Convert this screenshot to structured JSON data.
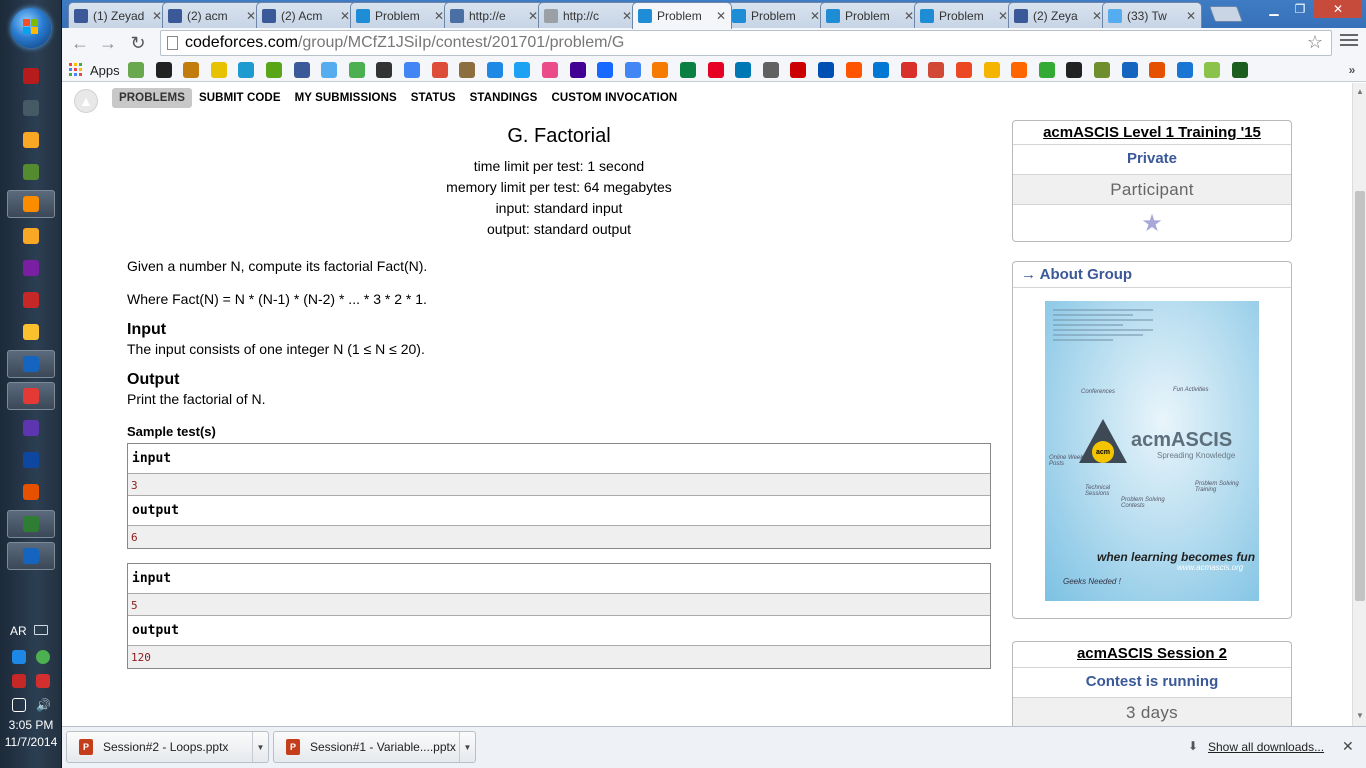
{
  "taskbar": {
    "icons": [
      "ar-app",
      "monitor",
      "media",
      "notes",
      "player",
      "explorer",
      "vs",
      "pdf",
      "messenger",
      "paint",
      "chrome",
      "vs-blend",
      "photoshop",
      "illustrator",
      "utorrent",
      "word"
    ],
    "lang": "AR",
    "time": "3:05 PM",
    "date": "11/7/2014"
  },
  "tabs": [
    {
      "title": "(1) Zeyad",
      "fav": "f",
      "color": "#3b5998"
    },
    {
      "title": "(2) acm",
      "fav": "f",
      "color": "#3b5998"
    },
    {
      "title": "(2) Acm",
      "fav": "f",
      "color": "#3b5998"
    },
    {
      "title": "Problem",
      "fav": "cf",
      "color": "#1f8dd6"
    },
    {
      "title": "http://e",
      "fav": "(",
      "color": "#4a6fa5"
    },
    {
      "title": "http://c",
      "fav": "doc",
      "color": "#9aa0a6"
    },
    {
      "title": "Problem",
      "fav": "cf",
      "color": "#1f8dd6"
    },
    {
      "title": "Problem",
      "fav": "cf",
      "color": "#1f8dd6"
    },
    {
      "title": "Problem",
      "fav": "cf",
      "color": "#1f8dd6"
    },
    {
      "title": "Problem",
      "fav": "cf",
      "color": "#1f8dd6"
    },
    {
      "title": "(2) Zeya",
      "fav": "f",
      "color": "#3b5998"
    },
    {
      "title": "(33) Tw",
      "fav": "t",
      "color": "#55acee"
    }
  ],
  "active_tab_index": 6,
  "address": {
    "host": "codeforces.com",
    "path": "/group/MCfZ1JSiIp/contest/201701/problem/G"
  },
  "bookmarks": {
    "apps_label": "Apps",
    "colors": [
      "#6aa84f",
      "#222",
      "#c27c0e",
      "#e6c200",
      "#1d9bd1",
      "#58a618",
      "#3b5998",
      "#55acee",
      "#4caf50",
      "#333",
      "#4285f4",
      "#dd4b39",
      "#8d6e3f",
      "#1e88e5",
      "#1da1f2",
      "#ea4c89",
      "#410093",
      "#1769ff",
      "#4285f4",
      "#f57c00",
      "#0b8043",
      "#e60023",
      "#0077b5",
      "#616161",
      "#cc0000",
      "#0050b3",
      "#ff5500",
      "#0078d4",
      "#d9302c",
      "#d14836",
      "#eb4924",
      "#f4b400",
      "#ff6600",
      "#33aa33",
      "#222",
      "#6f8f2f",
      "#1565c0",
      "#e65100",
      "#1976d2",
      "#8bc34a",
      "#1b5e20"
    ]
  },
  "menu": {
    "items": [
      "PROBLEMS",
      "SUBMIT CODE",
      "MY SUBMISSIONS",
      "STATUS",
      "STANDINGS",
      "CUSTOM INVOCATION"
    ],
    "current": 0
  },
  "problem": {
    "title": "G. Factorial",
    "time_limit": "time limit per test: 1 second",
    "memory_limit": "memory limit per test: 64 megabytes",
    "input": "input: standard input",
    "output": "output: standard output",
    "statement_1": "Given a number N, compute its factorial Fact(N).",
    "statement_2": "Where Fact(N) = N * (N-1) * (N-2) * ... * 3 * 2 * 1.",
    "input_title": "Input",
    "input_text": "The input consists of one integer N (1  ≤  N  ≤  20).",
    "output_title": "Output",
    "output_text": "Print the factorial of N.",
    "samples_title": "Sample test(s)",
    "samples": [
      {
        "input_label": "input",
        "input": "3",
        "output_label": "output",
        "output": "6"
      },
      {
        "input_label": "input",
        "input": "5",
        "output_label": "output",
        "output": "120"
      }
    ]
  },
  "sidebar": {
    "contest": {
      "title": "acmASCIS Level 1 Training '15",
      "visibility": "Private",
      "role": "Participant"
    },
    "about": {
      "title": "→ About Group",
      "poster": {
        "brand": "acmASCIS",
        "subtitle": "Spreading Knowledge",
        "circle": "acm",
        "tagline": "when learning becomes fun",
        "url": "www.acmascis.org",
        "geeks": "Geeks Needed !",
        "labels": [
          "Conferences",
          "Fun Activities",
          "Online Weekly Posts",
          "Technical Sessions",
          "Problem Solving Contests",
          "Problem Solving Training"
        ]
      }
    },
    "session": {
      "title": "acmASCIS Session 2",
      "status": "Contest is running",
      "remaining": "3 days"
    }
  },
  "downloads": {
    "items": [
      "Session#2 - Loops.pptx",
      "Session#1 - Variable....pptx"
    ],
    "show_all": "Show all downloads..."
  }
}
